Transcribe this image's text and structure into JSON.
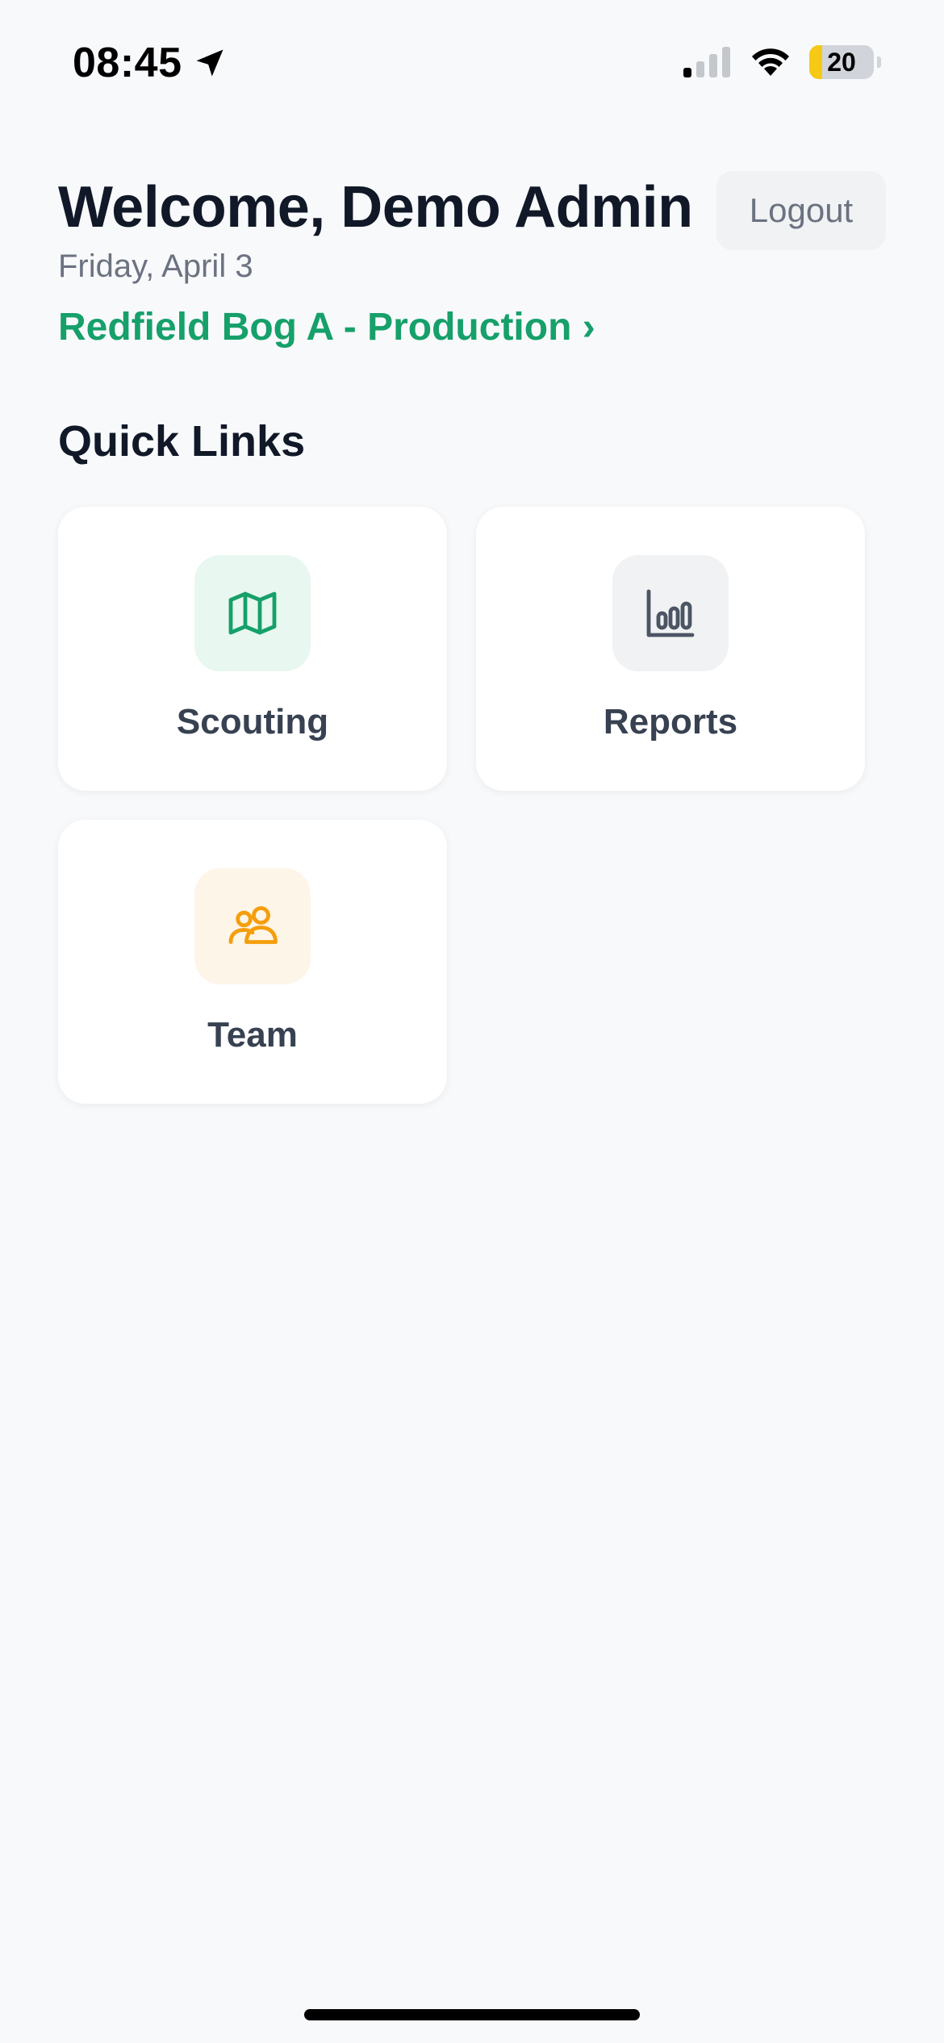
{
  "status_bar": {
    "time": "08:45",
    "battery_level": "20",
    "battery_percent": 20,
    "battery_color": "#f6c915"
  },
  "header": {
    "welcome": "Welcome, Demo Admin",
    "logout_label": "Logout",
    "date": "Friday, April 3",
    "farm_link": "Redfield Bog A - Production ›"
  },
  "quick_links": {
    "title": "Quick Links",
    "items": [
      {
        "label": "Scouting",
        "icon": "map-icon",
        "accent": "#16a06a",
        "bg": "#e8f7f0"
      },
      {
        "label": "Reports",
        "icon": "bar-chart-icon",
        "accent": "#4b5563",
        "bg": "#f1f2f4"
      },
      {
        "label": "Team",
        "icon": "users-icon",
        "accent": "#f59e0b",
        "bg": "#fdf5e8"
      }
    ]
  },
  "colors": {
    "background": "#f8f9fb",
    "primary_text": "#111827",
    "secondary_text": "#6b7280",
    "link_green": "#16a06a"
  }
}
